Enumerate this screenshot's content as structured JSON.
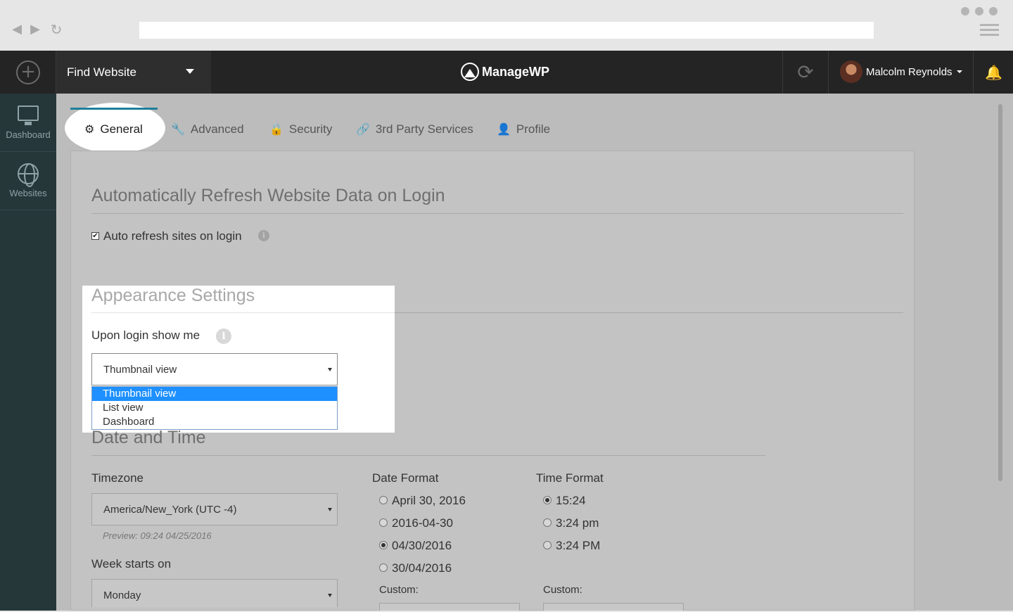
{
  "app": {
    "find_website": "Find Website",
    "logo_text": "ManageWP",
    "user_name": "Malcolm Reynolds"
  },
  "sidebar": {
    "items": [
      {
        "label": "Dashboard",
        "icon": "monitor-chart-icon"
      },
      {
        "label": "Websites",
        "icon": "globe-icon"
      }
    ]
  },
  "tabs": [
    {
      "label": "General",
      "icon": "gear-icon",
      "active": true
    },
    {
      "label": "Advanced",
      "icon": "wrench-icon"
    },
    {
      "label": "Security",
      "icon": "lock-icon"
    },
    {
      "label": "3rd Party Services",
      "icon": "link-icon"
    },
    {
      "label": "Profile",
      "icon": "user-icon"
    }
  ],
  "refresh_section": {
    "title": "Automatically Refresh Website Data on Login",
    "checkbox_label": "Auto refresh sites on login",
    "checked": true
  },
  "appearance": {
    "title": "Appearance Settings",
    "label": "Upon login show me",
    "selected": "Thumbnail view",
    "options": [
      "Thumbnail view",
      "List view",
      "Dashboard"
    ]
  },
  "datetime": {
    "title": "Date and Time",
    "timezone_label": "Timezone",
    "timezone_value": "America/New_York (UTC -4)",
    "preview": "Preview: 09:24 04/25/2016",
    "week_label": "Week starts on",
    "week_value": "Monday",
    "date_format_label": "Date Format",
    "date_formats": [
      {
        "label": "April 30, 2016",
        "checked": false
      },
      {
        "label": "2016-04-30",
        "checked": false
      },
      {
        "label": "04/30/2016",
        "checked": true
      },
      {
        "label": "30/04/2016",
        "checked": false
      }
    ],
    "time_format_label": "Time Format",
    "time_formats": [
      {
        "label": "15:24",
        "checked": true
      },
      {
        "label": "3:24 pm",
        "checked": false
      },
      {
        "label": "3:24 PM",
        "checked": false
      }
    ],
    "custom_label": "Custom:"
  },
  "colors": {
    "topbar": "#242424",
    "sidebar": "#26373a",
    "accent": "#1e7f9a",
    "dropdown_highlight": "#1e90ff"
  }
}
